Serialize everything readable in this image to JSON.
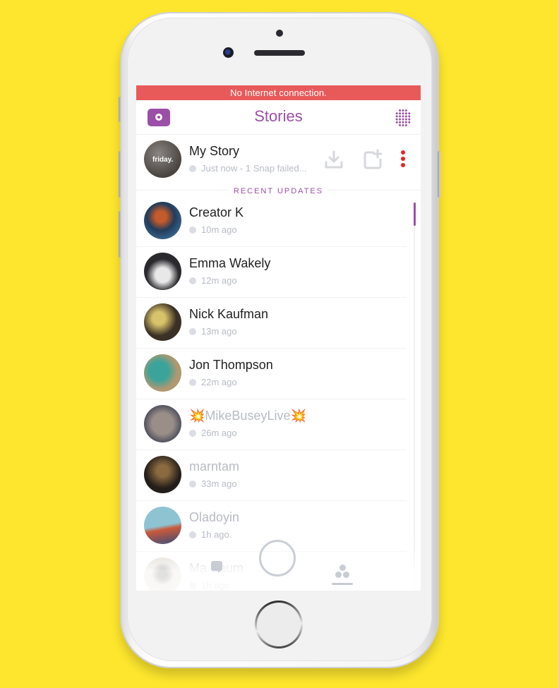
{
  "banner": {
    "text": "No Internet connection."
  },
  "header": {
    "title": "Stories",
    "left_icon": "camera-icon",
    "right_icon": "discover-grid-icon",
    "accent_color": "#9b4fa6"
  },
  "my_story": {
    "name": "My Story",
    "thumbnail_caption": "friday.",
    "status": "Just now - 1 Snap failed...",
    "actions": [
      {
        "icon": "download-icon"
      },
      {
        "icon": "add-story-icon"
      },
      {
        "icon": "more-options-icon"
      }
    ]
  },
  "section_label": "RECENT UPDATES",
  "stories": [
    {
      "name": "Creator K",
      "time": "10m ago",
      "viewed": false
    },
    {
      "name": "Emma Wakely",
      "time": "12m ago",
      "viewed": false
    },
    {
      "name": "Nick Kaufman",
      "time": "13m ago",
      "viewed": false
    },
    {
      "name": "Jon Thompson",
      "time": "22m ago",
      "viewed": false
    },
    {
      "name": "💥MikeBuseyLive💥",
      "time": "26m ago",
      "viewed": true
    },
    {
      "name": "marntam",
      "time": "33m ago",
      "viewed": true
    },
    {
      "name": "Oladoyin",
      "time": "1h ago",
      "viewed": true
    },
    {
      "name": "Ma Baum",
      "time": "1h ago",
      "viewed": true
    }
  ],
  "bottom_nav": {
    "left_icon": "chat-icon",
    "center_icon": "capture-button",
    "right_icon": "friends-icon"
  },
  "colors": {
    "background": "#fde62d",
    "banner": "#e85a5a",
    "accent": "#9b4fa6",
    "more_dots": "#e82323"
  }
}
